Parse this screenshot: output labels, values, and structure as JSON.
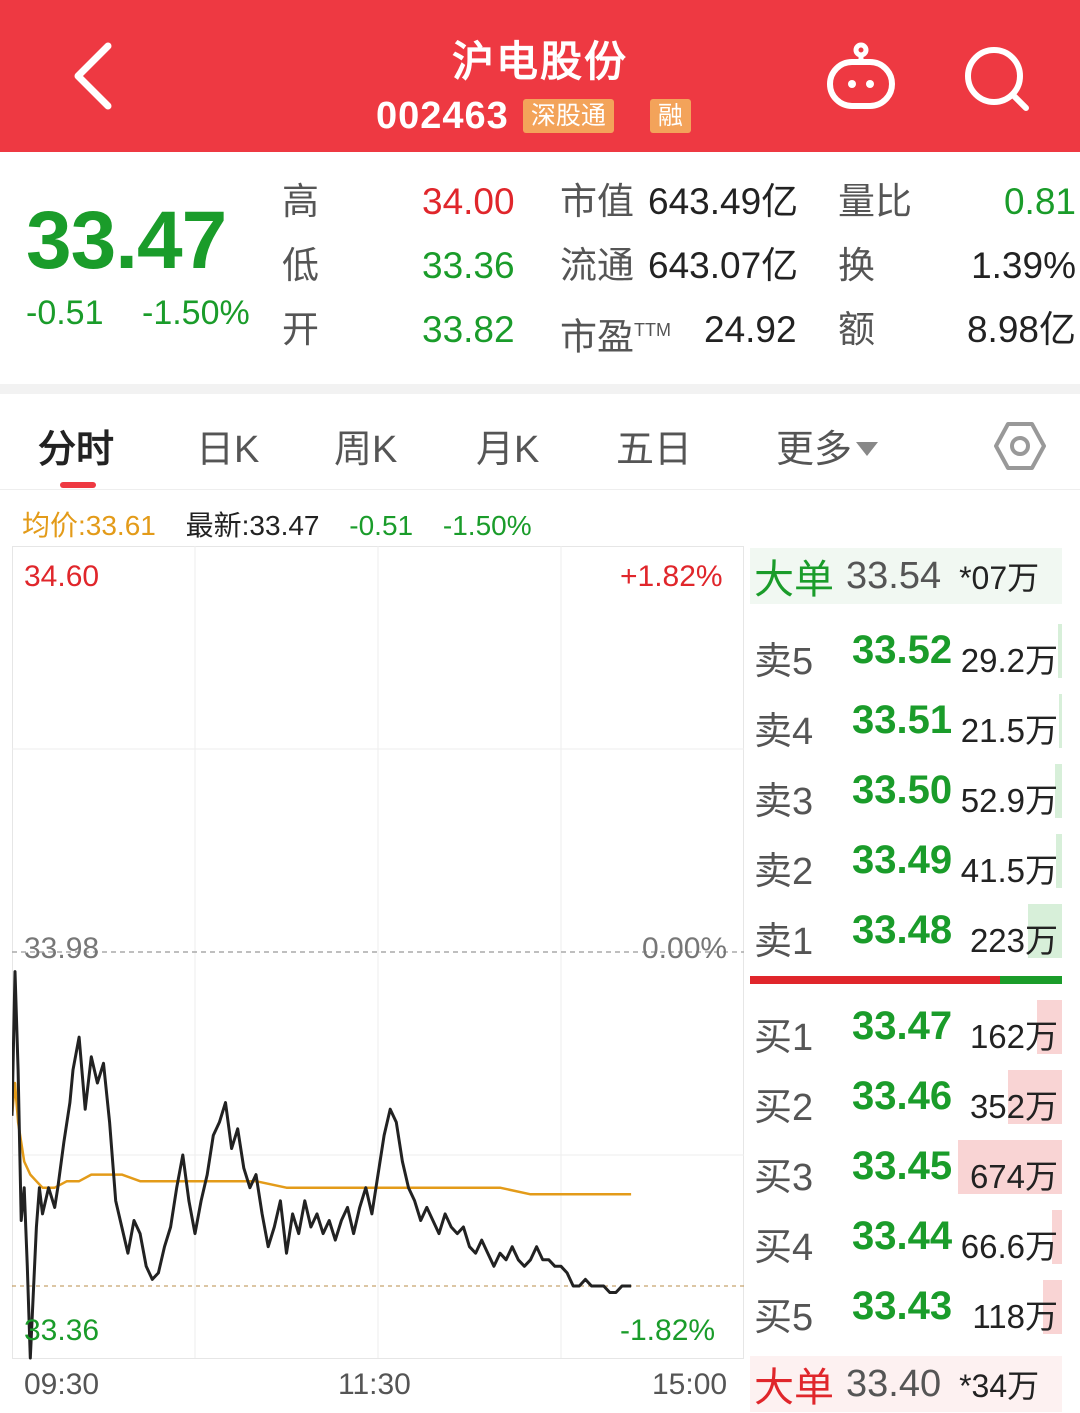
{
  "header": {
    "title": "沪电股份",
    "code": "002463",
    "tag_connect": "深股通",
    "tag_margin": "融"
  },
  "quote": {
    "price": "33.47",
    "change": "-0.51",
    "change_pct": "-1.50%",
    "high_label": "高",
    "high": "34.00",
    "low_label": "低",
    "low": "33.36",
    "open_label": "开",
    "open": "33.82",
    "mcap_label": "市值",
    "mcap": "643.49亿",
    "float_label": "流通",
    "float": "643.07亿",
    "pe_label": "市盈",
    "pe_sup": "TTM",
    "pe": "24.92",
    "vr_label": "量比",
    "vr": "0.81",
    "turn_label": "换",
    "turn": "1.39%",
    "amt_label": "额",
    "amt": "8.98亿"
  },
  "tabs": [
    {
      "label": "分时"
    },
    {
      "label": "日K"
    },
    {
      "label": "周K"
    },
    {
      "label": "月K"
    },
    {
      "label": "五日"
    },
    {
      "label": "更多"
    }
  ],
  "info": {
    "avg": "均价:33.61",
    "latest": "最新:33.47",
    "change": "-0.51",
    "change_pct": "-1.50%"
  },
  "chart_labels": {
    "y_top": "34.60",
    "y_mid": "33.98",
    "y_bottom": "33.36",
    "pct_top": "+1.82%",
    "pct_mid": "0.00%",
    "pct_bottom": "-1.82%",
    "x_start": "09:30",
    "x_mid": "11:30",
    "x_end": "15:00"
  },
  "chart_data": {
    "type": "line",
    "ylim": [
      33.36,
      34.6
    ],
    "pre_close": 33.98,
    "x_minutes_range": [
      0,
      240
    ],
    "series": [
      {
        "color": "#222222",
        "x": [
          0,
          1,
          2,
          3,
          4,
          5,
          6,
          8,
          9,
          10,
          12,
          14,
          15,
          17,
          19,
          20,
          22,
          24,
          26,
          28,
          30,
          32,
          34,
          36,
          38,
          40,
          42,
          44,
          46,
          48,
          50,
          52,
          54,
          56,
          58,
          60,
          62,
          64,
          66,
          68,
          70,
          72,
          74,
          76,
          78,
          80,
          82,
          84,
          86,
          88,
          90,
          92,
          94,
          96,
          98,
          100,
          102,
          104,
          106,
          108,
          110,
          112,
          114,
          116,
          118,
          120,
          122,
          124,
          126,
          128,
          130,
          132,
          134,
          136,
          138,
          140,
          142,
          144,
          146,
          148,
          150,
          152,
          154,
          156,
          158,
          160,
          162,
          164,
          166,
          168,
          170,
          172,
          174,
          176,
          178,
          180,
          182,
          184,
          186,
          188,
          190,
          192,
          194,
          196,
          198,
          200,
          202,
          203
        ],
        "y": [
          33.73,
          33.95,
          33.8,
          33.57,
          33.62,
          33.5,
          33.36,
          33.56,
          33.62,
          33.58,
          33.62,
          33.59,
          33.62,
          33.69,
          33.75,
          33.8,
          33.85,
          33.74,
          33.82,
          33.78,
          33.81,
          33.72,
          33.6,
          33.56,
          33.52,
          33.57,
          33.55,
          33.5,
          33.48,
          33.49,
          33.53,
          33.56,
          33.62,
          33.67,
          33.6,
          33.55,
          33.6,
          33.64,
          33.7,
          33.72,
          33.75,
          33.68,
          33.71,
          33.65,
          33.62,
          33.64,
          33.58,
          33.53,
          33.56,
          33.6,
          33.52,
          33.58,
          33.55,
          33.6,
          33.56,
          33.58,
          33.55,
          33.57,
          33.54,
          33.57,
          33.59,
          33.55,
          33.59,
          33.62,
          33.58,
          33.64,
          33.7,
          33.74,
          33.72,
          33.66,
          33.62,
          33.6,
          33.57,
          33.59,
          33.57,
          33.55,
          33.58,
          33.56,
          33.55,
          33.56,
          33.53,
          33.52,
          33.54,
          33.52,
          33.5,
          33.52,
          33.51,
          33.53,
          33.51,
          33.5,
          33.51,
          33.53,
          33.51,
          33.51,
          33.5,
          33.5,
          33.49,
          33.47,
          33.47,
          33.48,
          33.47,
          33.47,
          33.47,
          33.46,
          33.46,
          33.47,
          33.47,
          33.47
        ]
      },
      {
        "color": "#e39b19",
        "x": [
          0,
          1,
          2,
          4,
          6,
          8,
          10,
          14,
          18,
          22,
          26,
          30,
          36,
          42,
          50,
          60,
          70,
          80,
          90,
          100,
          110,
          120,
          130,
          140,
          150,
          160,
          170,
          180,
          190,
          200,
          203
        ],
        "y": [
          33.73,
          33.78,
          33.72,
          33.66,
          33.64,
          33.63,
          33.62,
          33.62,
          33.63,
          33.63,
          33.64,
          33.64,
          33.64,
          33.63,
          33.63,
          33.63,
          33.63,
          33.63,
          33.62,
          33.62,
          33.62,
          33.62,
          33.62,
          33.62,
          33.62,
          33.62,
          33.61,
          33.61,
          33.61,
          33.61,
          33.61
        ]
      }
    ]
  },
  "orderbook": {
    "big_top": {
      "label": "大单",
      "price": "33.54",
      "vol": "*07万"
    },
    "asks": [
      {
        "label": "卖5",
        "price": "33.52",
        "vol": "29.2万",
        "ratio": 0.04
      },
      {
        "label": "卖4",
        "price": "33.51",
        "vol": "21.5万",
        "ratio": 0.03
      },
      {
        "label": "卖3",
        "price": "33.50",
        "vol": "52.9万",
        "ratio": 0.07
      },
      {
        "label": "卖2",
        "price": "33.49",
        "vol": "41.5万",
        "ratio": 0.06
      },
      {
        "label": "卖1",
        "price": "33.48",
        "vol": "223万",
        "ratio": 0.33
      }
    ],
    "bid_ratio": 0.8,
    "bids": [
      {
        "label": "买1",
        "price": "33.47",
        "vol": "162万",
        "ratio": 0.24
      },
      {
        "label": "买2",
        "price": "33.46",
        "vol": "352万",
        "ratio": 0.52
      },
      {
        "label": "买3",
        "price": "33.45",
        "vol": "674万",
        "ratio": 1.0
      },
      {
        "label": "买4",
        "price": "33.44",
        "vol": "66.6万",
        "ratio": 0.1
      },
      {
        "label": "买5",
        "price": "33.43",
        "vol": "118万",
        "ratio": 0.18
      }
    ],
    "big_bottom": {
      "label": "大单",
      "price": "33.40",
      "vol": "*34万"
    }
  },
  "colors": {
    "header": "#ee3942",
    "up": "#e0262b",
    "down": "#1a9c2a",
    "avg_line": "#e39b19"
  }
}
